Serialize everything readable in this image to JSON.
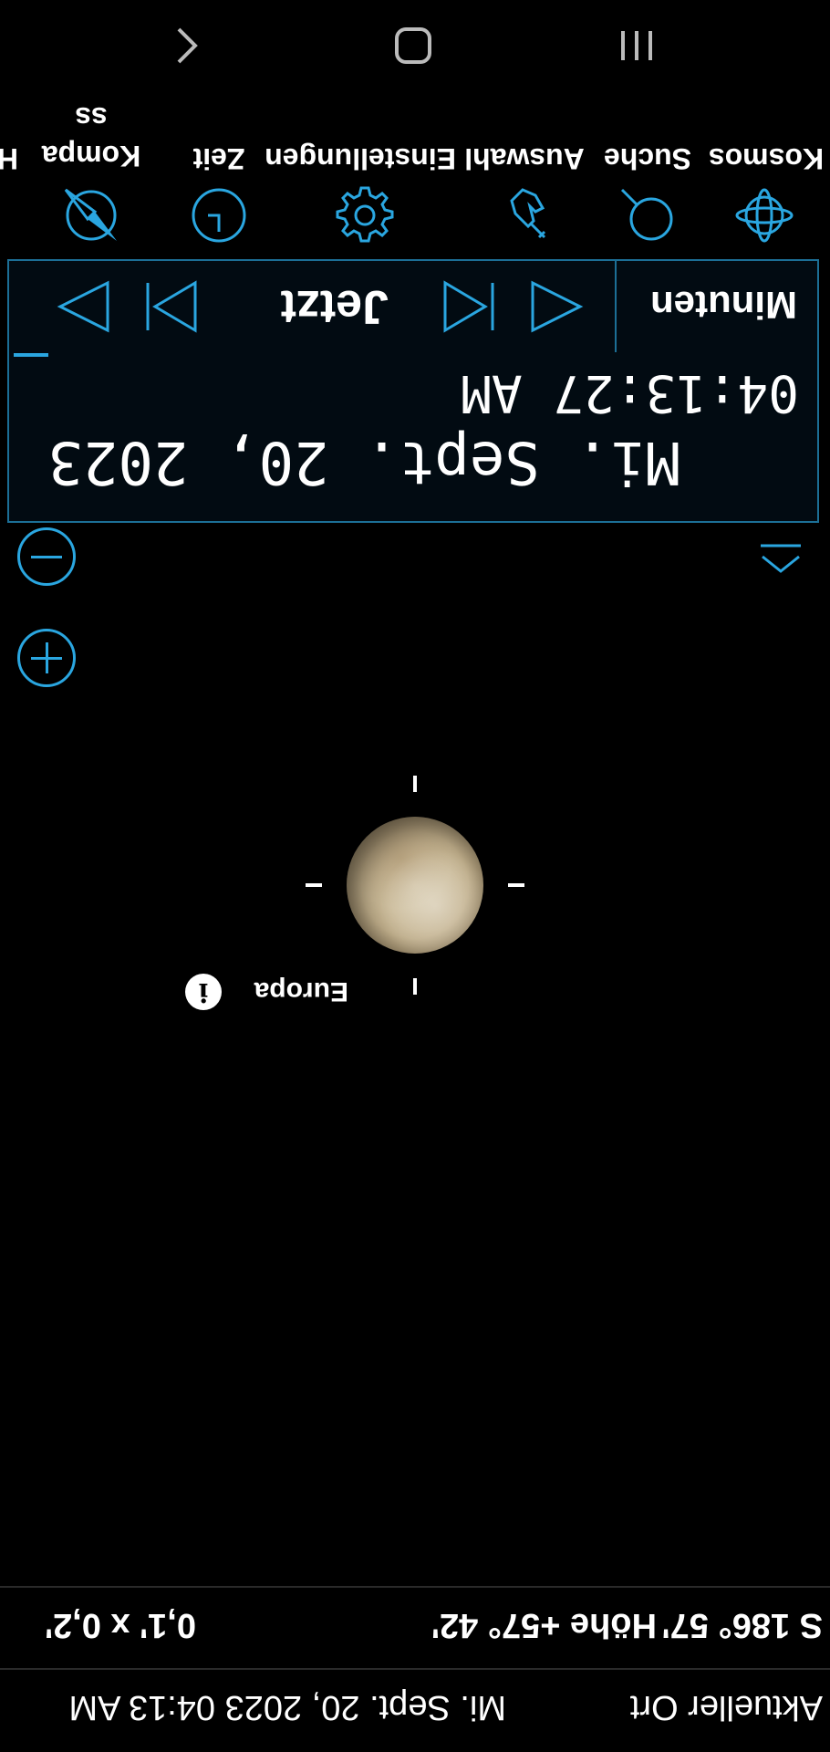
{
  "status": {
    "location": "Aktueller Ort",
    "datetime": "Mi. Sept. 20, 2023  04:13 AM"
  },
  "coordinates": {
    "azimuth": "S  186° 57'",
    "altitude": "Höhe +57° 42'",
    "fov": "0,1' x  0,2'"
  },
  "object": {
    "name": "Europa",
    "info_icon": "info-icon"
  },
  "time_panel": {
    "date": "Mi. Sept. 20, 2023",
    "time": "04:13:27 AM",
    "unit": "Minuten",
    "now_label": "Jetzt"
  },
  "toolbar": {
    "items": [
      {
        "label": "Kosmos",
        "icon": "orbit-icon"
      },
      {
        "label": "Suche",
        "icon": "search-icon"
      },
      {
        "label": "Auswahl",
        "icon": "hand-pointer-icon"
      },
      {
        "label": "Einstellungen",
        "icon": "gear-icon"
      },
      {
        "label": "Zeit",
        "icon": "clock-icon"
      },
      {
        "label": "Kompa ss",
        "icon": "compass-icon"
      },
      {
        "label": "H",
        "icon": "help-icon"
      }
    ]
  },
  "colors": {
    "accent": "#2aa6e0",
    "panel_border": "#1c6f96",
    "background": "#000000"
  },
  "navbar": [
    "recents-icon",
    "home-icon",
    "back-icon"
  ]
}
